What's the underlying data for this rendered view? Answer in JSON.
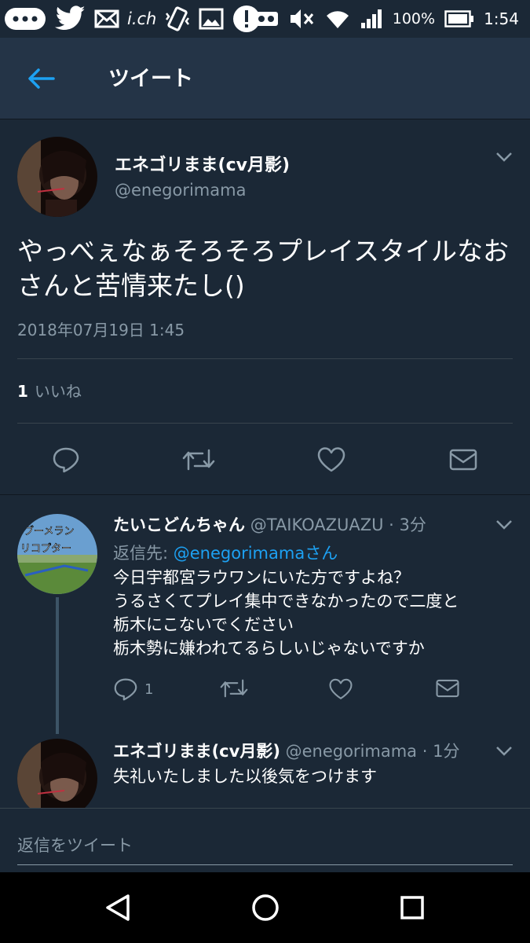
{
  "status_bar": {
    "notif_icons": [
      "message-icon",
      "twitter-icon",
      "mail-icon",
      "ich-app-icon",
      "vibrate-icon",
      "image-icon",
      "alert-icon"
    ],
    "ich_label": "i.ch",
    "battery_text": "100%",
    "time": "1:54"
  },
  "header": {
    "title": "ツイート"
  },
  "main_tweet": {
    "name": "エネゴリまま(cv月影)",
    "handle": "@enegorimama",
    "text": "やっべぇなぁそろそろプレイスタイルなおさんと苦情来たし()",
    "date": "2018年07月19日 1:45",
    "like_count": "1",
    "like_label": "いいね"
  },
  "reply1": {
    "name": "たいこどんちゃん",
    "handle": "@TAIKOAZUAZU",
    "sep": " · ",
    "time": "3分",
    "replyto_label": "返信先: ",
    "replyto_link": "@enegorimamaさん",
    "text": "今日宇都宮ラウワンにいた方ですよね？\nうるさくてプレイ集中できなかったので二度と\n栃木にこないでください\n栃木勢に嫌われてるらしいじゃないですか",
    "reply_count": "1",
    "avatar_text": "ブーメラン\nリコプター"
  },
  "reply2": {
    "name": "エネゴリまま(cv月影)",
    "handle": "@enegorimama",
    "sep": " · ",
    "time": "1分",
    "text": "失礼いたしました以後気をつけます"
  },
  "compose": {
    "placeholder": "返信をツイート"
  },
  "colors": {
    "bg": "#1b2836",
    "header_bg": "#243447",
    "accent": "#1da1f2",
    "muted": "#8899a6"
  }
}
